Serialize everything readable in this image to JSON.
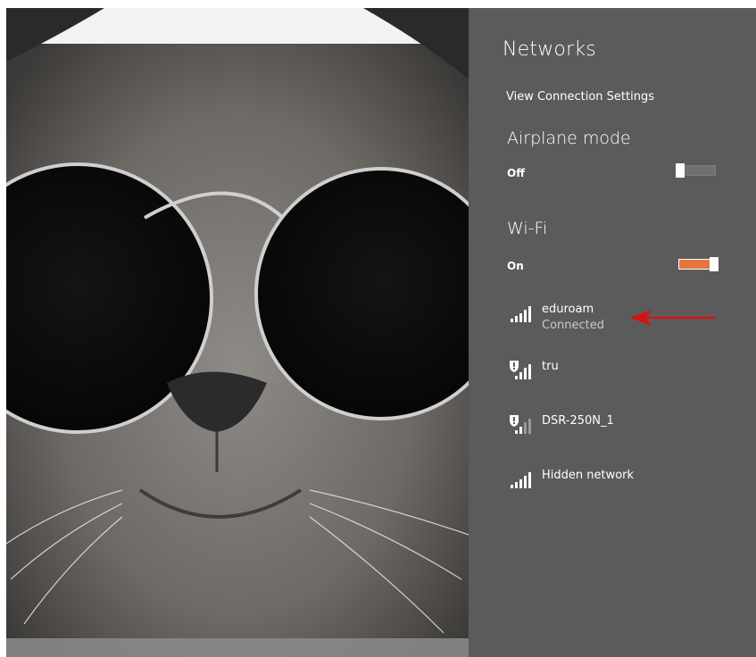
{
  "panel": {
    "title": "Networks",
    "view_settings_link": "View Connection Settings"
  },
  "airplane_mode": {
    "title": "Airplane mode",
    "state": "Off"
  },
  "wifi": {
    "title": "Wi-Fi",
    "state": "On",
    "accent_color": "#e3773a"
  },
  "networks": [
    {
      "name": "eduroam",
      "status": "Connected",
      "icon": "wifi-signal-icon",
      "secured": false
    },
    {
      "name": "tru",
      "status": "",
      "icon": "wifi-secured-icon",
      "secured": true
    },
    {
      "name": "DSR-250N_1",
      "status": "",
      "icon": "wifi-secured-icon",
      "secured": true
    },
    {
      "name": "Hidden network",
      "status": "",
      "icon": "wifi-signal-icon",
      "secured": false
    }
  ],
  "annotation": {
    "icon": "red-arrow-icon",
    "color": "#d41414"
  }
}
